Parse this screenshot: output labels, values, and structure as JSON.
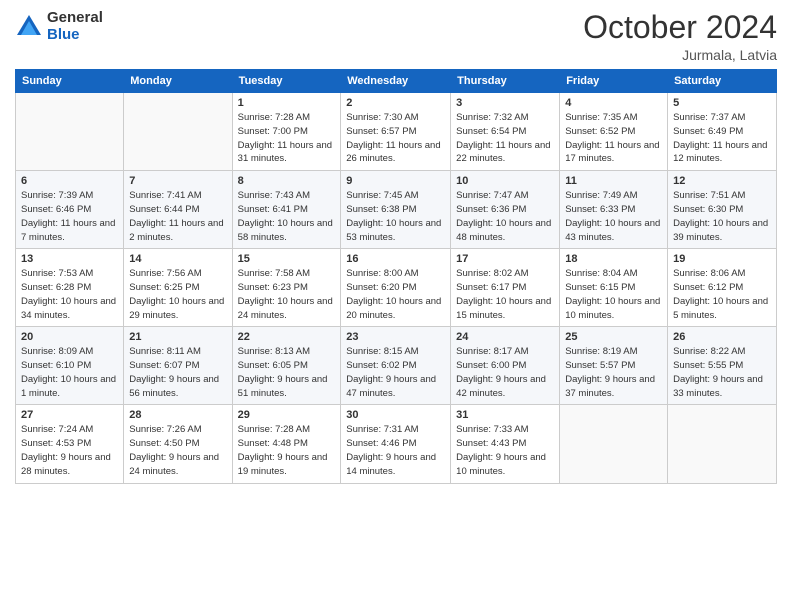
{
  "header": {
    "logo_general": "General",
    "logo_blue": "Blue",
    "title": "October 2024",
    "location": "Jurmala, Latvia"
  },
  "days_of_week": [
    "Sunday",
    "Monday",
    "Tuesday",
    "Wednesday",
    "Thursday",
    "Friday",
    "Saturday"
  ],
  "weeks": [
    [
      {
        "num": "",
        "detail": ""
      },
      {
        "num": "",
        "detail": ""
      },
      {
        "num": "1",
        "detail": "Sunrise: 7:28 AM\nSunset: 7:00 PM\nDaylight: 11 hours and 31 minutes."
      },
      {
        "num": "2",
        "detail": "Sunrise: 7:30 AM\nSunset: 6:57 PM\nDaylight: 11 hours and 26 minutes."
      },
      {
        "num": "3",
        "detail": "Sunrise: 7:32 AM\nSunset: 6:54 PM\nDaylight: 11 hours and 22 minutes."
      },
      {
        "num": "4",
        "detail": "Sunrise: 7:35 AM\nSunset: 6:52 PM\nDaylight: 11 hours and 17 minutes."
      },
      {
        "num": "5",
        "detail": "Sunrise: 7:37 AM\nSunset: 6:49 PM\nDaylight: 11 hours and 12 minutes."
      }
    ],
    [
      {
        "num": "6",
        "detail": "Sunrise: 7:39 AM\nSunset: 6:46 PM\nDaylight: 11 hours and 7 minutes."
      },
      {
        "num": "7",
        "detail": "Sunrise: 7:41 AM\nSunset: 6:44 PM\nDaylight: 11 hours and 2 minutes."
      },
      {
        "num": "8",
        "detail": "Sunrise: 7:43 AM\nSunset: 6:41 PM\nDaylight: 10 hours and 58 minutes."
      },
      {
        "num": "9",
        "detail": "Sunrise: 7:45 AM\nSunset: 6:38 PM\nDaylight: 10 hours and 53 minutes."
      },
      {
        "num": "10",
        "detail": "Sunrise: 7:47 AM\nSunset: 6:36 PM\nDaylight: 10 hours and 48 minutes."
      },
      {
        "num": "11",
        "detail": "Sunrise: 7:49 AM\nSunset: 6:33 PM\nDaylight: 10 hours and 43 minutes."
      },
      {
        "num": "12",
        "detail": "Sunrise: 7:51 AM\nSunset: 6:30 PM\nDaylight: 10 hours and 39 minutes."
      }
    ],
    [
      {
        "num": "13",
        "detail": "Sunrise: 7:53 AM\nSunset: 6:28 PM\nDaylight: 10 hours and 34 minutes."
      },
      {
        "num": "14",
        "detail": "Sunrise: 7:56 AM\nSunset: 6:25 PM\nDaylight: 10 hours and 29 minutes."
      },
      {
        "num": "15",
        "detail": "Sunrise: 7:58 AM\nSunset: 6:23 PM\nDaylight: 10 hours and 24 minutes."
      },
      {
        "num": "16",
        "detail": "Sunrise: 8:00 AM\nSunset: 6:20 PM\nDaylight: 10 hours and 20 minutes."
      },
      {
        "num": "17",
        "detail": "Sunrise: 8:02 AM\nSunset: 6:17 PM\nDaylight: 10 hours and 15 minutes."
      },
      {
        "num": "18",
        "detail": "Sunrise: 8:04 AM\nSunset: 6:15 PM\nDaylight: 10 hours and 10 minutes."
      },
      {
        "num": "19",
        "detail": "Sunrise: 8:06 AM\nSunset: 6:12 PM\nDaylight: 10 hours and 5 minutes."
      }
    ],
    [
      {
        "num": "20",
        "detail": "Sunrise: 8:09 AM\nSunset: 6:10 PM\nDaylight: 10 hours and 1 minute."
      },
      {
        "num": "21",
        "detail": "Sunrise: 8:11 AM\nSunset: 6:07 PM\nDaylight: 9 hours and 56 minutes."
      },
      {
        "num": "22",
        "detail": "Sunrise: 8:13 AM\nSunset: 6:05 PM\nDaylight: 9 hours and 51 minutes."
      },
      {
        "num": "23",
        "detail": "Sunrise: 8:15 AM\nSunset: 6:02 PM\nDaylight: 9 hours and 47 minutes."
      },
      {
        "num": "24",
        "detail": "Sunrise: 8:17 AM\nSunset: 6:00 PM\nDaylight: 9 hours and 42 minutes."
      },
      {
        "num": "25",
        "detail": "Sunrise: 8:19 AM\nSunset: 5:57 PM\nDaylight: 9 hours and 37 minutes."
      },
      {
        "num": "26",
        "detail": "Sunrise: 8:22 AM\nSunset: 5:55 PM\nDaylight: 9 hours and 33 minutes."
      }
    ],
    [
      {
        "num": "27",
        "detail": "Sunrise: 7:24 AM\nSunset: 4:53 PM\nDaylight: 9 hours and 28 minutes."
      },
      {
        "num": "28",
        "detail": "Sunrise: 7:26 AM\nSunset: 4:50 PM\nDaylight: 9 hours and 24 minutes."
      },
      {
        "num": "29",
        "detail": "Sunrise: 7:28 AM\nSunset: 4:48 PM\nDaylight: 9 hours and 19 minutes."
      },
      {
        "num": "30",
        "detail": "Sunrise: 7:31 AM\nSunset: 4:46 PM\nDaylight: 9 hours and 14 minutes."
      },
      {
        "num": "31",
        "detail": "Sunrise: 7:33 AM\nSunset: 4:43 PM\nDaylight: 9 hours and 10 minutes."
      },
      {
        "num": "",
        "detail": ""
      },
      {
        "num": "",
        "detail": ""
      }
    ]
  ]
}
